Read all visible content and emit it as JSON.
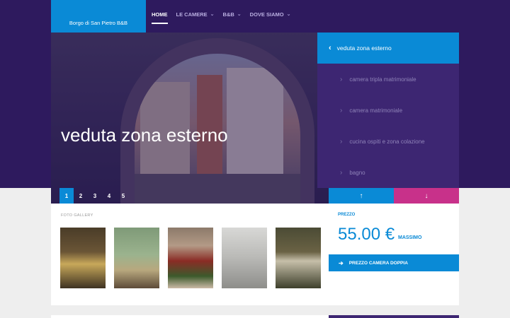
{
  "site": {
    "logo_text": "Borgo di San Pietro B&B"
  },
  "nav": {
    "items": [
      {
        "label": "HOME",
        "active": true
      },
      {
        "label": "LE CAMERE",
        "active": false
      },
      {
        "label": "B&B",
        "active": false
      },
      {
        "label": "DOVE SIAMO",
        "active": false
      }
    ]
  },
  "hero": {
    "title": "veduta zona esterno",
    "pages": [
      "1",
      "2",
      "3",
      "4",
      "5"
    ],
    "current_page": "1"
  },
  "slides": {
    "active": "veduta zona esterno",
    "items": [
      "camera tripla matrimoniale",
      "camera matrimoniale",
      "cucina ospiti e zona colazione",
      "bagno"
    ]
  },
  "gallery": {
    "label": "FOTO GALLERY",
    "thumbs": 5
  },
  "price": {
    "label": "PREZZO",
    "value": "55.00 €",
    "qualifier": "MASSIMO",
    "button": "PREZZO CAMERA DOPPIA"
  },
  "colors": {
    "accent_blue": "#0a8ad6",
    "accent_pink": "#c8318a",
    "brand_purple": "#2e1a5e"
  },
  "icons": {
    "chevron": "chevron-down-icon",
    "arrow_left": "chevron-left-icon",
    "arrow_right": "chevron-right-icon",
    "arrow_up": "arrow-up-icon",
    "arrow_down": "arrow-down-icon"
  }
}
